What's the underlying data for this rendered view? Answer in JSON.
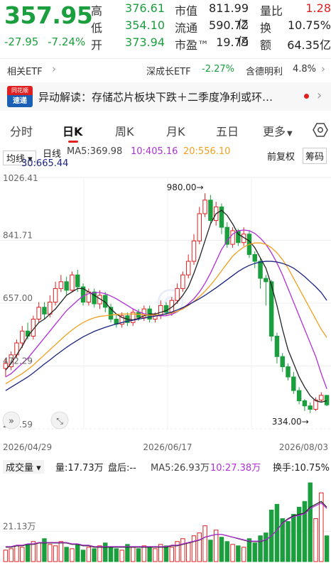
{
  "quote": {
    "price": "357.95",
    "change": "-27.95",
    "change_pct": "-7.24%",
    "rows": [
      [
        {
          "label": "高",
          "value": "376.61",
          "color": "green"
        },
        {
          "label": "市值",
          "value": "811.99亿",
          "color": "normal"
        },
        {
          "label": "量比",
          "value": "1.28",
          "color": "red"
        }
      ],
      [
        {
          "label": "低",
          "value": "354.10",
          "color": "green"
        },
        {
          "label": "流通",
          "value": "590.72亿",
          "color": "normal"
        },
        {
          "label": "换",
          "value": "10.75%",
          "color": "normal"
        }
      ],
      [
        {
          "label": "开",
          "value": "373.94",
          "color": "green"
        },
        {
          "label": "市盈™",
          "value": "19.79",
          "color": "normal"
        },
        {
          "label": "额",
          "value": "64.35亿",
          "color": "normal"
        }
      ]
    ]
  },
  "etf": {
    "related_label": "相关ETF",
    "fund_name": "深成长ETF",
    "fund_change": "-2.27%",
    "holder_label": "含德明利",
    "holder_pct": "4.8%"
  },
  "news": {
    "badge_top": "同花顺",
    "badge_bottom": "速递",
    "text": "异动解读：存储芯片板块下跌＋二季度净利或环…"
  },
  "tabs": [
    {
      "label": "分时"
    },
    {
      "label": "日K"
    },
    {
      "label": "周K"
    },
    {
      "label": "月K"
    },
    {
      "label": "五日"
    },
    {
      "label": "更多"
    }
  ],
  "active_tab": "日K",
  "ma_bar": {
    "indicator": "均线",
    "period": "日线",
    "ma5": "MA5:369.98",
    "ma10": "10:405.16",
    "ma20": "20:556.10",
    "ma30": "30:665.44",
    "adjust": "前复权",
    "chips": "筹码"
  },
  "colors": {
    "up": "#e02020",
    "down": "#1b9e3e",
    "ma5": "#222222",
    "ma10": "#b02fd6",
    "ma20": "#f0a020",
    "ma30": "#1a237e"
  },
  "chart_data": {
    "type": "candlestick",
    "y_ticks": [
      "1026.41",
      "841.71",
      "657.00",
      "472.29",
      "287.59"
    ],
    "x_ticks": [
      "2026/04/29",
      "2026/06/17",
      "2026/08/03"
    ],
    "annotations": {
      "high": "980.00",
      "low": "334.00"
    },
    "ylim": [
      287.59,
      1026.41
    ],
    "candles": [
      [
        465,
        480,
        440,
        495
      ],
      [
        470,
        505,
        460,
        515
      ],
      [
        505,
        540,
        495,
        550
      ],
      [
        540,
        575,
        525,
        590
      ],
      [
        575,
        560,
        550,
        600
      ],
      [
        560,
        610,
        550,
        620
      ],
      [
        610,
        645,
        600,
        660
      ],
      [
        645,
        625,
        610,
        660
      ],
      [
        625,
        660,
        615,
        680
      ],
      [
        660,
        700,
        650,
        720
      ],
      [
        700,
        720,
        690,
        740
      ],
      [
        720,
        695,
        680,
        735
      ],
      [
        695,
        740,
        690,
        750
      ],
      [
        740,
        705,
        690,
        755
      ],
      [
        705,
        660,
        650,
        715
      ],
      [
        660,
        690,
        650,
        700
      ],
      [
        690,
        655,
        645,
        700
      ],
      [
        655,
        680,
        640,
        695
      ],
      [
        680,
        645,
        630,
        690
      ],
      [
        645,
        610,
        600,
        655
      ],
      [
        610,
        595,
        585,
        625
      ],
      [
        595,
        620,
        585,
        630
      ],
      [
        620,
        600,
        590,
        630
      ],
      [
        600,
        630,
        590,
        640
      ],
      [
        630,
        615,
        605,
        640
      ],
      [
        615,
        640,
        605,
        650
      ],
      [
        640,
        610,
        600,
        650
      ],
      [
        610,
        620,
        600,
        630
      ],
      [
        620,
        650,
        610,
        665
      ],
      [
        650,
        630,
        620,
        660
      ],
      [
        630,
        665,
        620,
        675
      ],
      [
        665,
        700,
        655,
        715
      ],
      [
        700,
        740,
        690,
        750
      ],
      [
        740,
        780,
        730,
        800
      ],
      [
        780,
        840,
        770,
        860
      ],
      [
        840,
        920,
        830,
        940
      ],
      [
        920,
        960,
        910,
        980
      ],
      [
        960,
        900,
        890,
        975
      ],
      [
        900,
        940,
        885,
        955
      ],
      [
        940,
        880,
        860,
        950
      ],
      [
        880,
        830,
        820,
        895
      ],
      [
        830,
        870,
        820,
        880
      ],
      [
        870,
        835,
        825,
        875
      ],
      [
        835,
        860,
        825,
        880
      ],
      [
        860,
        800,
        790,
        870
      ],
      [
        800,
        780,
        760,
        810
      ],
      [
        780,
        730,
        700,
        790
      ],
      [
        730,
        720,
        650,
        740
      ],
      [
        720,
        560,
        545,
        725
      ],
      [
        560,
        500,
        480,
        570
      ],
      [
        500,
        470,
        455,
        510
      ],
      [
        470,
        440,
        430,
        480
      ],
      [
        440,
        400,
        390,
        455
      ],
      [
        400,
        370,
        360,
        410
      ],
      [
        370,
        355,
        340,
        375
      ],
      [
        355,
        345,
        334,
        365
      ],
      [
        345,
        372,
        340,
        380
      ],
      [
        372,
        386,
        365,
        395
      ],
      [
        386,
        358,
        354,
        377
      ]
    ],
    "ma5": [
      460,
      480,
      505,
      530,
      560,
      580,
      600,
      610,
      625,
      640,
      660,
      680,
      690,
      700,
      700,
      690,
      680,
      670,
      660,
      640,
      625,
      615,
      610,
      608,
      612,
      620,
      625,
      625,
      630,
      635,
      645,
      660,
      680,
      705,
      745,
      790,
      840,
      890,
      920,
      930,
      915,
      890,
      860,
      850,
      840,
      820,
      790,
      760,
      710,
      650,
      580,
      520,
      480,
      440,
      410,
      385,
      370,
      366,
      370
    ],
    "ma10": [
      440,
      450,
      465,
      480,
      495,
      515,
      535,
      555,
      575,
      595,
      615,
      635,
      650,
      665,
      678,
      685,
      688,
      688,
      685,
      678,
      670,
      660,
      650,
      640,
      632,
      626,
      622,
      620,
      620,
      620,
      624,
      632,
      642,
      655,
      670,
      690,
      715,
      745,
      780,
      815,
      840,
      860,
      870,
      872,
      870,
      862,
      848,
      830,
      805,
      775,
      740,
      700,
      660,
      620,
      580,
      540,
      500,
      450,
      405
    ],
    "ma20": [
      420,
      430,
      440,
      450,
      462,
      475,
      490,
      505,
      520,
      535,
      550,
      565,
      578,
      590,
      600,
      608,
      614,
      618,
      620,
      622,
      624,
      625,
      625,
      625,
      624,
      623,
      622,
      622,
      623,
      625,
      628,
      633,
      640,
      650,
      662,
      676,
      692,
      710,
      730,
      752,
      774,
      795,
      810,
      822,
      830,
      834,
      834,
      830,
      820,
      805,
      785,
      760,
      730,
      700,
      670,
      640,
      610,
      580,
      556
    ],
    "ma30": [
      400,
      410,
      420,
      430,
      440,
      452,
      465,
      478,
      490,
      503,
      515,
      527,
      538,
      548,
      558,
      566,
      574,
      580,
      586,
      591,
      596,
      600,
      604,
      607,
      610,
      613,
      616,
      619,
      622,
      626,
      631,
      637,
      644,
      652,
      661,
      670,
      680,
      691,
      702,
      714,
      726,
      738,
      750,
      760,
      768,
      774,
      778,
      780,
      780,
      778,
      774,
      768,
      760,
      748,
      735,
      720,
      705,
      688,
      665
    ]
  },
  "volume_bar": {
    "indicator": "成交量",
    "vol": "量:17.73万",
    "after_hours": "盘后:--",
    "ma5": "MA5:26.93万",
    "ma10": "10:27.38万",
    "turnover": "换手:10.75%",
    "y_tick": "21.13万",
    "volumes": [
      8,
      9,
      11,
      10,
      12,
      14,
      13,
      16,
      12,
      11,
      14,
      10,
      9,
      12,
      8,
      10,
      9,
      11,
      13,
      10,
      9,
      8,
      12,
      10,
      9,
      11,
      10,
      9,
      12,
      11,
      10,
      14,
      16,
      13,
      18,
      20,
      25,
      15,
      22,
      17,
      14,
      12,
      11,
      10,
      16,
      13,
      18,
      20,
      36,
      40,
      30,
      28,
      33,
      38,
      42,
      55,
      30,
      48,
      18
    ],
    "vol_ma5": [
      10,
      10,
      11,
      11,
      12,
      12,
      13,
      13,
      13,
      13,
      13,
      13,
      12,
      12,
      11,
      11,
      10,
      10,
      10,
      10,
      10,
      10,
      10,
      10,
      10,
      10,
      10,
      10,
      10,
      10,
      11,
      11,
      12,
      13,
      14,
      15,
      17,
      18,
      19,
      19,
      18,
      17,
      16,
      15,
      14,
      14,
      14,
      15,
      18,
      22,
      27,
      30,
      32,
      33,
      34,
      38,
      40,
      42,
      38
    ]
  }
}
